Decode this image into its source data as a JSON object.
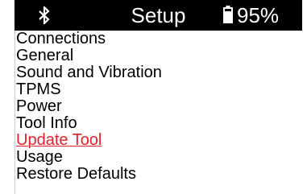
{
  "header": {
    "title": "Setup",
    "bluetooth_icon": "bluetooth-icon",
    "battery_icon": "battery-icon",
    "battery_percent": "95%"
  },
  "menu": {
    "items": [
      {
        "label": "Connections"
      },
      {
        "label": "General"
      },
      {
        "label": "Sound and Vibration"
      },
      {
        "label": "TPMS"
      },
      {
        "label": "Power"
      },
      {
        "label": "Tool Info"
      },
      {
        "label": "Update Tool",
        "selected": true
      },
      {
        "label": "Usage"
      },
      {
        "label": "Restore Defaults"
      }
    ]
  },
  "colors": {
    "header_bg": "#000000",
    "header_text": "#ffffff",
    "item_text": "#000000",
    "selected_text": "#e8202a"
  }
}
